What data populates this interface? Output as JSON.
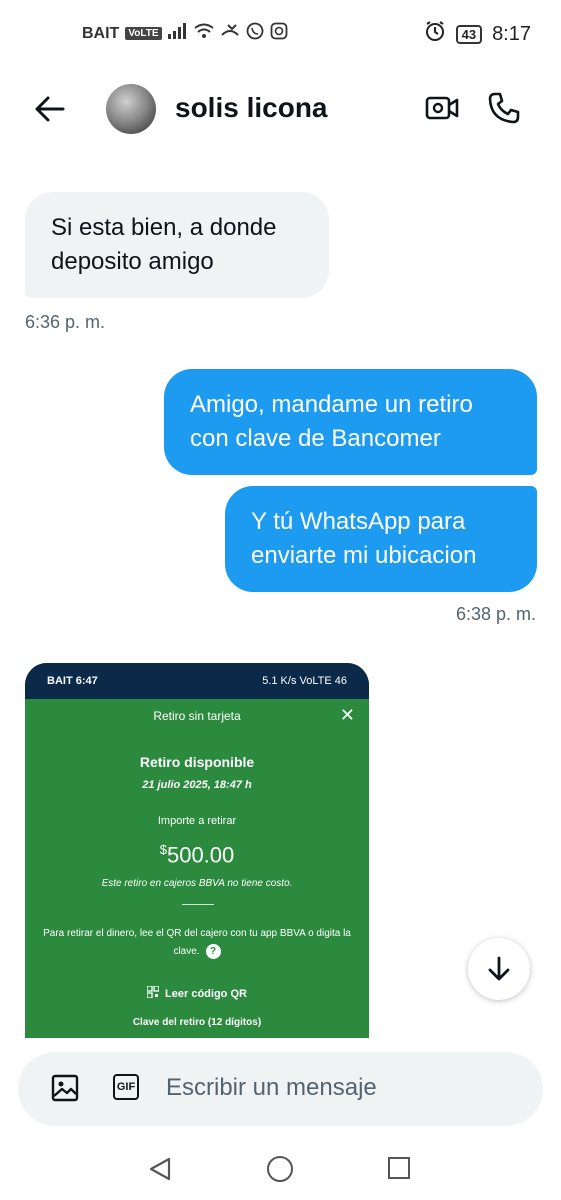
{
  "status_bar": {
    "carrier": "BAIT",
    "volte": "VoLTE",
    "battery": "43",
    "time": "8:17"
  },
  "header": {
    "name": "solis licona"
  },
  "messages": [
    {
      "direction": "incoming",
      "text": "Si esta bien, a donde deposito amigo"
    },
    {
      "direction": "outgoing",
      "text": "Amigo, mandame un retiro con clave de Bancomer"
    },
    {
      "direction": "outgoing",
      "text": "Y tú WhatsApp para enviarte mi ubicacion"
    }
  ],
  "timestamps": {
    "incoming": "6:36 p. m.",
    "outgoing": "6:38 p. m."
  },
  "attachment": {
    "status_left": "BAIT 6:47",
    "status_right": "5.1 K/s  VoLTE  46",
    "screen_title": "Retiro sin tarjeta",
    "heading": "Retiro disponible",
    "date": "21 julio 2025, 18:47 h",
    "amount_label": "Importe a retirar",
    "currency": "$",
    "amount": "500.00",
    "note": "Este retiro en cajeros BBVA no tiene costo.",
    "instructions": "Para retirar el dinero, lee el QR del cajero con tu app BBVA o digita la clave.",
    "qr_label": "Leer código QR",
    "clave_label": "Clave del retiro (12 dígitos)"
  },
  "composer": {
    "placeholder": "Escribir un mensaje",
    "gif_label": "GIF"
  },
  "colors": {
    "accent": "#1d9bf0",
    "incoming_bubble": "#eff3f4",
    "bbva_green": "#2b8a3e",
    "bbva_bar": "#0b2a4a"
  }
}
